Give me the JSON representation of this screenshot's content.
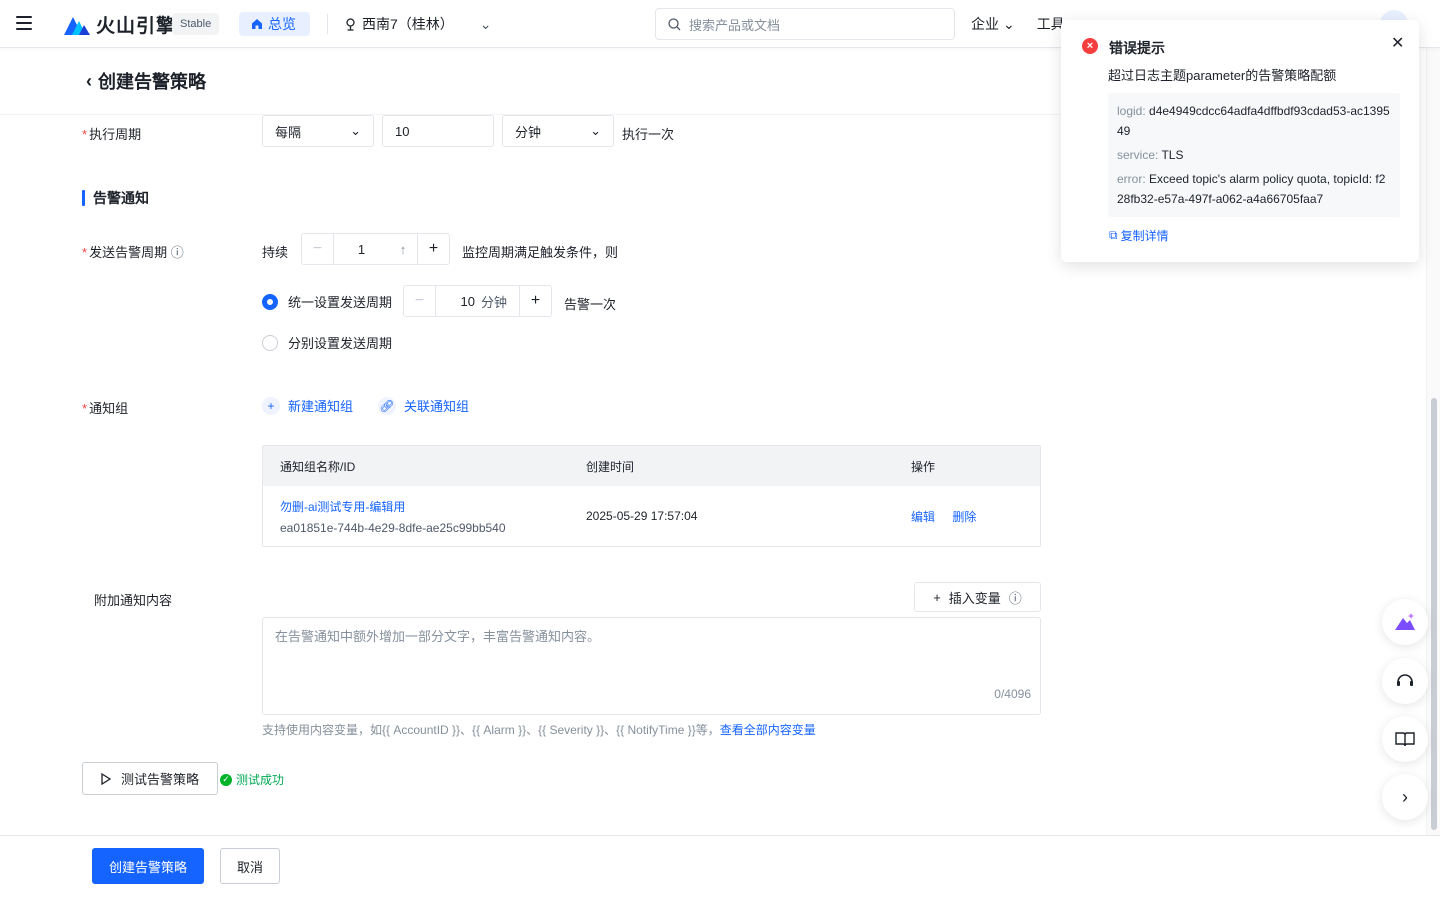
{
  "topbar": {
    "brand": "火山引擎",
    "env_badge": "Stable",
    "home_label": "总览",
    "region": "西南7（桂林）",
    "search_placeholder": "搜索产品或文档",
    "nav_items": [
      "企业",
      "工具"
    ]
  },
  "page": {
    "title": "创建告警策略"
  },
  "exec_cycle": {
    "label": "执行周期",
    "mode": "每隔",
    "value": "10",
    "unit": "分钟",
    "suffix": "执行一次"
  },
  "notify_section": {
    "title": "告警通知",
    "send_cycle_label": "发送告警周期",
    "persist_label": "持续",
    "persist_value": "1",
    "persist_suffix": "监控周期满足触发条件，则",
    "radio_unified": "统一设置发送周期",
    "unified_value": "10",
    "unified_unit": "分钟",
    "unified_suffix": "告警一次",
    "radio_separate": "分别设置发送周期",
    "group_label": "通知组",
    "new_group": "新建通知组",
    "link_group": "关联通知组"
  },
  "table": {
    "headers": [
      "通知组名称/ID",
      "创建时间",
      "操作"
    ],
    "rows": [
      {
        "name": "勿删-ai测试专用-编辑用",
        "id": "ea01851e-744b-4e29-8dfe-ae25c99bb540",
        "created": "2025-05-29 17:57:04",
        "edit": "编辑",
        "delete": "删除"
      }
    ]
  },
  "extra": {
    "label": "附加通知内容",
    "insert_var": "插入变量",
    "placeholder": "在告警通知中额外增加一部分文字，丰富告警通知内容。",
    "counter": "0/4096",
    "help": "支持使用内容变量，如{{ AccountID }}、{{ Alarm }}、{{ Severity }}、{{ NotifyTime }}等，",
    "help_link": "查看全部内容变量"
  },
  "test": {
    "button": "测试告警策略",
    "result": "测试成功"
  },
  "footer": {
    "create": "创建告警策略",
    "cancel": "取消"
  },
  "toast": {
    "title": "错误提示",
    "message": "超过日志主题parameter的告警策略配额",
    "logid_key": "logid:",
    "logid": "d4e4949cdcc64adfa4dffbdf93cdad53-ac139549",
    "service_key": "service:",
    "service": "TLS",
    "error_key": "error:",
    "error": "Exceed topic's alarm policy quota, topicId: f228fb32-e57a-497f-a062-a4a66705faa7",
    "copy": "复制详情"
  },
  "colors": {
    "primary": "#1664ff",
    "danger": "#f53f3f",
    "success": "#00b42a"
  }
}
